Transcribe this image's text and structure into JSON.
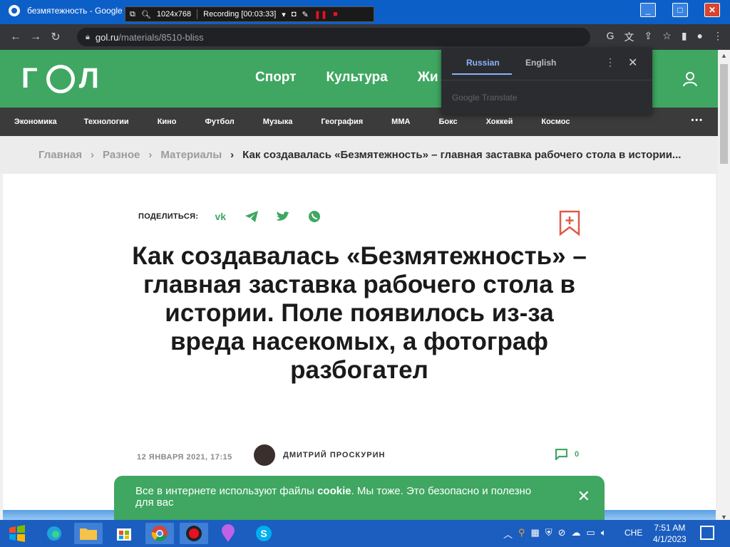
{
  "window": {
    "tab_title": "безмятежность - Google",
    "recorder": {
      "size": "1024x768",
      "status": "Recording [00:03:33]"
    }
  },
  "browser": {
    "url_host": "gol.ru",
    "url_path": "/materials/8510-bliss"
  },
  "site": {
    "main_nav": [
      "Спорт",
      "Культура",
      "Жи"
    ],
    "categories": [
      "Экономика",
      "Технологии",
      "Кино",
      "Футбол",
      "Музыка",
      "География",
      "MMA",
      "Бокс",
      "Хоккей",
      "Космос"
    ],
    "more": "•••"
  },
  "breadcrumbs": {
    "items": [
      "Главная",
      "Разное",
      "Материалы"
    ],
    "current": "Как создавалась «Безмятежность» – главная заставка рабочего стола в истории..."
  },
  "article": {
    "share_label": "ПОДЕЛИТЬСЯ:",
    "title": "Как создавалась «Безмятежность» – главная заставка рабочего стола в истории. Поле появилось из-за вреда насекомых, а фотограф разбогател",
    "date": "12 ЯНВАРЯ 2021, 17:15",
    "author": "ДМИТРИЙ ПРОСКУРИН",
    "comment_count": "0"
  },
  "cookie": {
    "text_before": "Все в интернете используют файлы ",
    "text_bold": "cookie",
    "text_after": ". Мы тоже. Это безопасно и полезно для вас"
  },
  "translate": {
    "lang_source": "Russian",
    "lang_target": "English",
    "brand": "Google Translate"
  },
  "taskbar": {
    "language": "CHE",
    "time": "7:51 AM",
    "date": "4/1/2023"
  },
  "colors": {
    "brand_green": "#3fa761",
    "nav_dark": "#3b3b3b",
    "titlebar_blue": "#0d5fc8",
    "taskbar_blue": "#1b5ebf"
  }
}
